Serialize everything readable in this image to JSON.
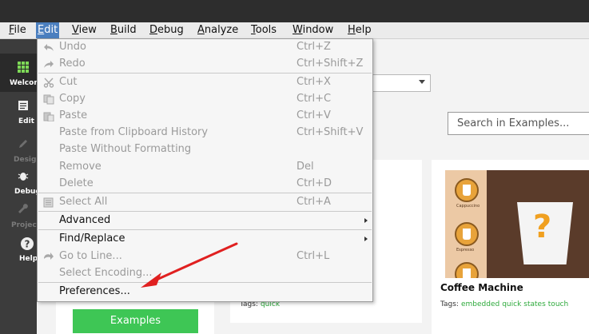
{
  "menubar": {
    "items": [
      {
        "label": "File",
        "accel": "F",
        "rest": "ile"
      },
      {
        "label": "Edit",
        "accel": "E",
        "rest": "dit"
      },
      {
        "label": "View",
        "accel": "V",
        "rest": "iew"
      },
      {
        "label": "Build",
        "accel": "B",
        "rest": "uild"
      },
      {
        "label": "Debug",
        "accel": "D",
        "rest": "ebug"
      },
      {
        "label": "Analyze",
        "accel": "A",
        "rest": "nalyze"
      },
      {
        "label": "Tools",
        "accel": "T",
        "rest": "ools"
      },
      {
        "label": "Window",
        "accel": "W",
        "rest": "indow"
      },
      {
        "label": "Help",
        "accel": "H",
        "rest": "elp"
      }
    ]
  },
  "sidebar": {
    "items": [
      {
        "label": "Welcome",
        "icon": "grid-icon"
      },
      {
        "label": "Edit",
        "icon": "document-icon"
      },
      {
        "label": "Design",
        "icon": "pencil-icon"
      },
      {
        "label": "Debug",
        "icon": "bug-icon"
      },
      {
        "label": "Projects",
        "icon": "wrench-icon"
      },
      {
        "label": "Help",
        "icon": "question-icon"
      }
    ]
  },
  "edit_menu": {
    "items": [
      {
        "label": "Undo",
        "shortcut": "Ctrl+Z",
        "icon": "undo-icon"
      },
      {
        "label": "Redo",
        "shortcut": "Ctrl+Shift+Z",
        "icon": "redo-icon"
      },
      {
        "label": "Cut",
        "shortcut": "Ctrl+X",
        "icon": "cut-icon"
      },
      {
        "label": "Copy",
        "shortcut": "Ctrl+C",
        "icon": "copy-icon"
      },
      {
        "label": "Paste",
        "shortcut": "Ctrl+V",
        "icon": "paste-icon"
      },
      {
        "label": "Paste from Clipboard History",
        "shortcut": "Ctrl+Shift+V"
      },
      {
        "label": "Paste Without Formatting",
        "shortcut": ""
      },
      {
        "label": "Remove",
        "shortcut": "Del"
      },
      {
        "label": "Delete",
        "shortcut": "Ctrl+D"
      },
      {
        "label": "Select All",
        "shortcut": "Ctrl+A",
        "icon": "select-all-icon"
      },
      {
        "label": "Advanced",
        "shortcut": ""
      },
      {
        "label": "Find/Replace",
        "shortcut": ""
      },
      {
        "label": "Go to Line...",
        "shortcut": "Ctrl+L",
        "icon": "goto-icon"
      },
      {
        "label": "Select Encoding...",
        "shortcut": ""
      },
      {
        "label": "Preferences...",
        "shortcut": ""
      }
    ]
  },
  "main": {
    "search_placeholder": "Search in Examples...",
    "examples_button": "Examples",
    "card1_tags_label": "Tags:",
    "card1_tags": [
      "quick"
    ],
    "card2_title": "Coffee Machine",
    "card2_tags_label": "Tags:",
    "card2_tags": [
      "embedded",
      "quick",
      "states",
      "touch"
    ],
    "thumb_labels": [
      "Cappuccino",
      "Espresso"
    ]
  },
  "colors": {
    "accent": "#4b7fbf",
    "annotation_arrow": "#e02020",
    "tag_green": "#2eaa3c",
    "button_green": "#3ec655"
  }
}
